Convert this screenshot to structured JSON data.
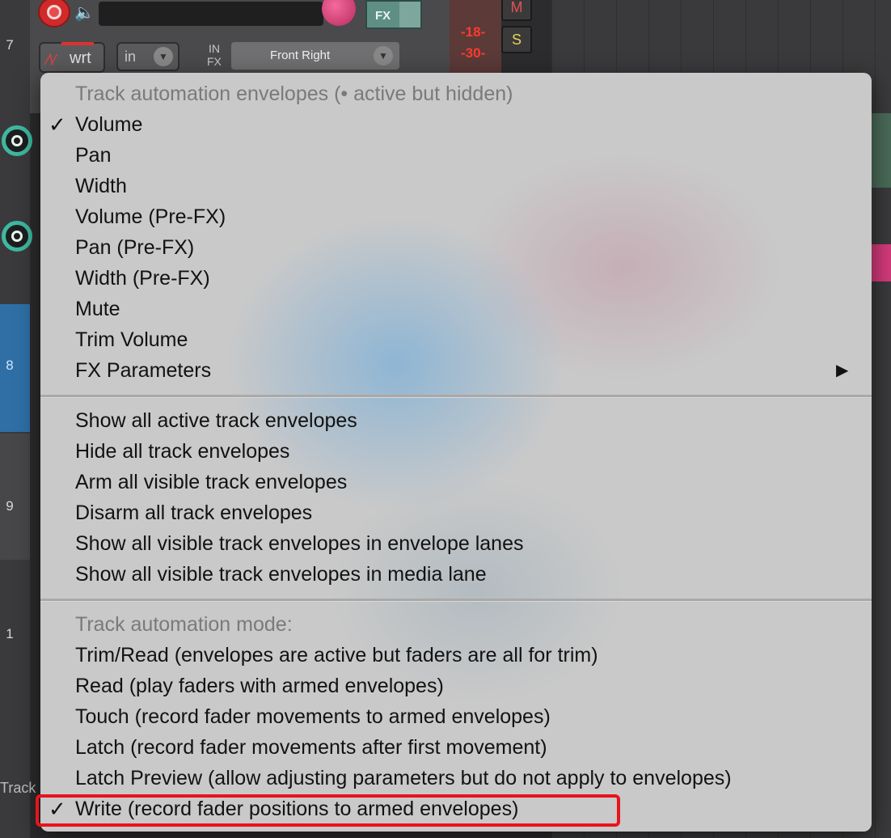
{
  "background": {
    "track_numbers": [
      "7",
      "8",
      "9",
      "1"
    ],
    "wrt_label": "wrt",
    "in_label": "in",
    "io_label": "IN\nFX",
    "route_label": "Front Right",
    "fx_label": "FX",
    "meter_values": [
      "-18-",
      "-30-"
    ],
    "mute_label": "M",
    "solo_label": "S",
    "bottom_label": "Track"
  },
  "menu": {
    "envelopes_header": "Track automation envelopes (• active but hidden)",
    "envelope_items": [
      {
        "label": "Volume",
        "checked": true
      },
      {
        "label": "Pan",
        "checked": false
      },
      {
        "label": "Width",
        "checked": false
      },
      {
        "label": "Volume (Pre-FX)",
        "checked": false
      },
      {
        "label": "Pan (Pre-FX)",
        "checked": false
      },
      {
        "label": "Width (Pre-FX)",
        "checked": false
      },
      {
        "label": "Mute",
        "checked": false
      },
      {
        "label": "Trim Volume",
        "checked": false
      },
      {
        "label": "FX Parameters",
        "checked": false,
        "submenu": true
      }
    ],
    "action_items": [
      "Show all active track envelopes",
      "Hide all track envelopes",
      "Arm all visible track envelopes",
      "Disarm all track envelopes",
      "Show all visible track envelopes in envelope lanes",
      "Show all visible track envelopes in media lane"
    ],
    "mode_header": "Track automation mode:",
    "mode_items": [
      {
        "label": "Trim/Read (envelopes are active but faders are all for trim)",
        "checked": false
      },
      {
        "label": "Read (play faders with armed envelopes)",
        "checked": false
      },
      {
        "label": "Touch (record fader movements to armed envelopes)",
        "checked": false
      },
      {
        "label": "Latch (record fader movements after first movement)",
        "checked": false
      },
      {
        "label": "Latch Preview (allow adjusting parameters but do not apply to envelopes)",
        "checked": false
      },
      {
        "label": "Write (record fader positions to armed envelopes)",
        "checked": true
      }
    ],
    "check_glyph": "✓",
    "submenu_glyph": "▶"
  },
  "colors": {
    "highlight": "#e8141c",
    "record": "#d12a2a",
    "accent_teal": "#3fb8a0"
  }
}
